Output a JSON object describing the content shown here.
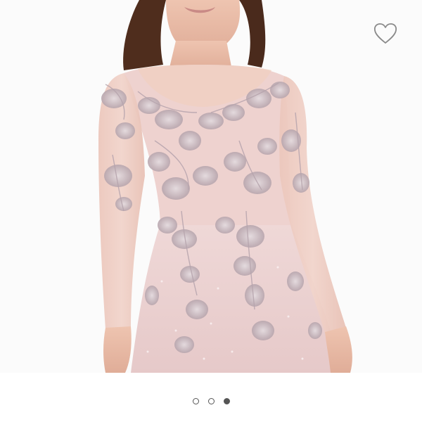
{
  "product_image": {
    "label": "",
    "image_count": 3,
    "active_index": 2
  },
  "favorite": {
    "icon": "heart-outline-icon",
    "selected": false,
    "color": "#8a8a8a"
  },
  "carousel": {
    "dots": [
      {
        "state": "inactive"
      },
      {
        "state": "inactive"
      },
      {
        "state": "active"
      }
    ]
  },
  "colors": {
    "background": "#ffffff",
    "dress": "#ecd3d2",
    "lace": "#c9b8bd",
    "skin": "#e8b9a5",
    "hair": "#4a2a1c",
    "dot": "#555555"
  }
}
